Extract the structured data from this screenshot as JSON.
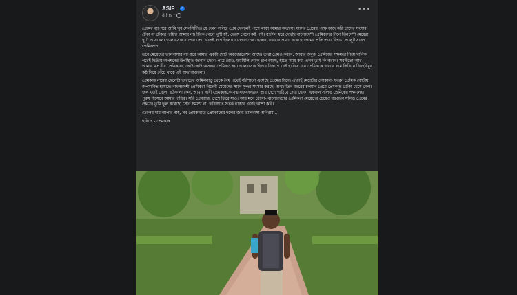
{
  "post": {
    "author": "ASIF",
    "time": "8 hrs",
    "paragraphs": [
      "প্রেমের ব্যাপারে আমি খুব সেনসিটিভ। যে কোন সলিড প্রেম দেখলেই পাশে থাকা আমার অভ্যাস। যাদের প্রেমের পক্ষে কাজ করি তাদের সংসার টেকা না টেকার দায়িত্ব আমার না। টিকে গেলে খুশী হই, ভেঙ্গে গেলে কষ্ট পাই। বহুদিন ধরে দেখছি বাংলাদেশী প্রেমিকদের টানে ভিনদেশী মেয়েরা ছুটে আসছেন। ভালবাসার ব্যাপার তো, ভালই লাগছিলো। বাংলাদেশের ছেলেরা বারবার প্রমাণ করেছে প্রেমের প্রতি তারা বিশ্বস্ত। স্যালুট সফল প্রেমিকগন।",
      "তবে মেয়েদের ভালবাসার ব্যাপারে আমার একটা ছোট অবজারভেশন আছে। তারা প্রেমও করবে, আবার অবুজ প্রেমিকের সক্ষমতা নিয়ে খানিক পরেই দ্বিতীয় অপশনের উপস্থিতি জানান দেবে। পাত্র রেডি, ফ্যামিলি থেকে চাপ আছে, হাতে সময় কম, এখন তুমি কি করবে। সবাইতো আর আমার মত বীর প্রেমিক না, কেউ কেউ অসহায় প্রেমিকও হয়। ভালবাসার হিসাব নিকাশে যেই হারিয়ে যায় প্রেমিককে খাতায় নাম লিখিয়ে বিরহবিধুর কষ্ট নিয়ে বেঁচে থাকে এই অভাগাগুলো।",
      "প্রেমকান্ত নামের ছেলেটা ভারতের অমিলনাড়ু থেকে বৈধ পথেই বরিশালে এসেছে প্রেমের টানে। এখনই মেয়েটার লোকাল- ফরেন প্রেমিক কোটায় অপমানিত হয়েছে। বাংলাদেশী প্রেমিকরা বিদেশী মেয়েদের সাথে সুন্দর সংসার করছে, অথচ তিন বছরের চলমান প্রেমে প্রেমকান্ত ধোঁকা খেয়ে গেল। জল যতই ঘোলা হউক না কেন, আমার দাবী প্রেমকান্তকে সম্মানজনকভাবে তার দেশে পাঠিয়ে দেয়া হোক। একজন সলিড প্রেমিকের পক্ষ নেয়া পুরুষ হিসেবে আমার দায়িত্ব। সরি প্রেমকান্ত, দেশে ফিরে যাও। আর মনে রেখো- বাংলাদেশের প্রেমিকরা মেয়েদের চেয়েও বহুগুনে সলিড প্রেমের ক্ষেত্রে। তুমি ভুল করেছো সেটা সমস্যা না, ভবিষ্যতে সতর্ক থাকবে এটাই আশা করি।",
      "তেলের দাম ব্যাপার নাহ, সব প্রেমকান্তরে প্রেমকান্তের দলের জন্য ভালবাসা অবিরাম...",
      "ছবিতে - প্রেমকান্ত"
    ]
  },
  "colors": {
    "background": "#18191a",
    "card": "#242526",
    "text": "#e4e6eb",
    "muted": "#b0b3b8",
    "verified": "#1877f2"
  },
  "icons": [
    "avatar",
    "verified-badge-icon",
    "globe-icon",
    "more-options-icon"
  ]
}
